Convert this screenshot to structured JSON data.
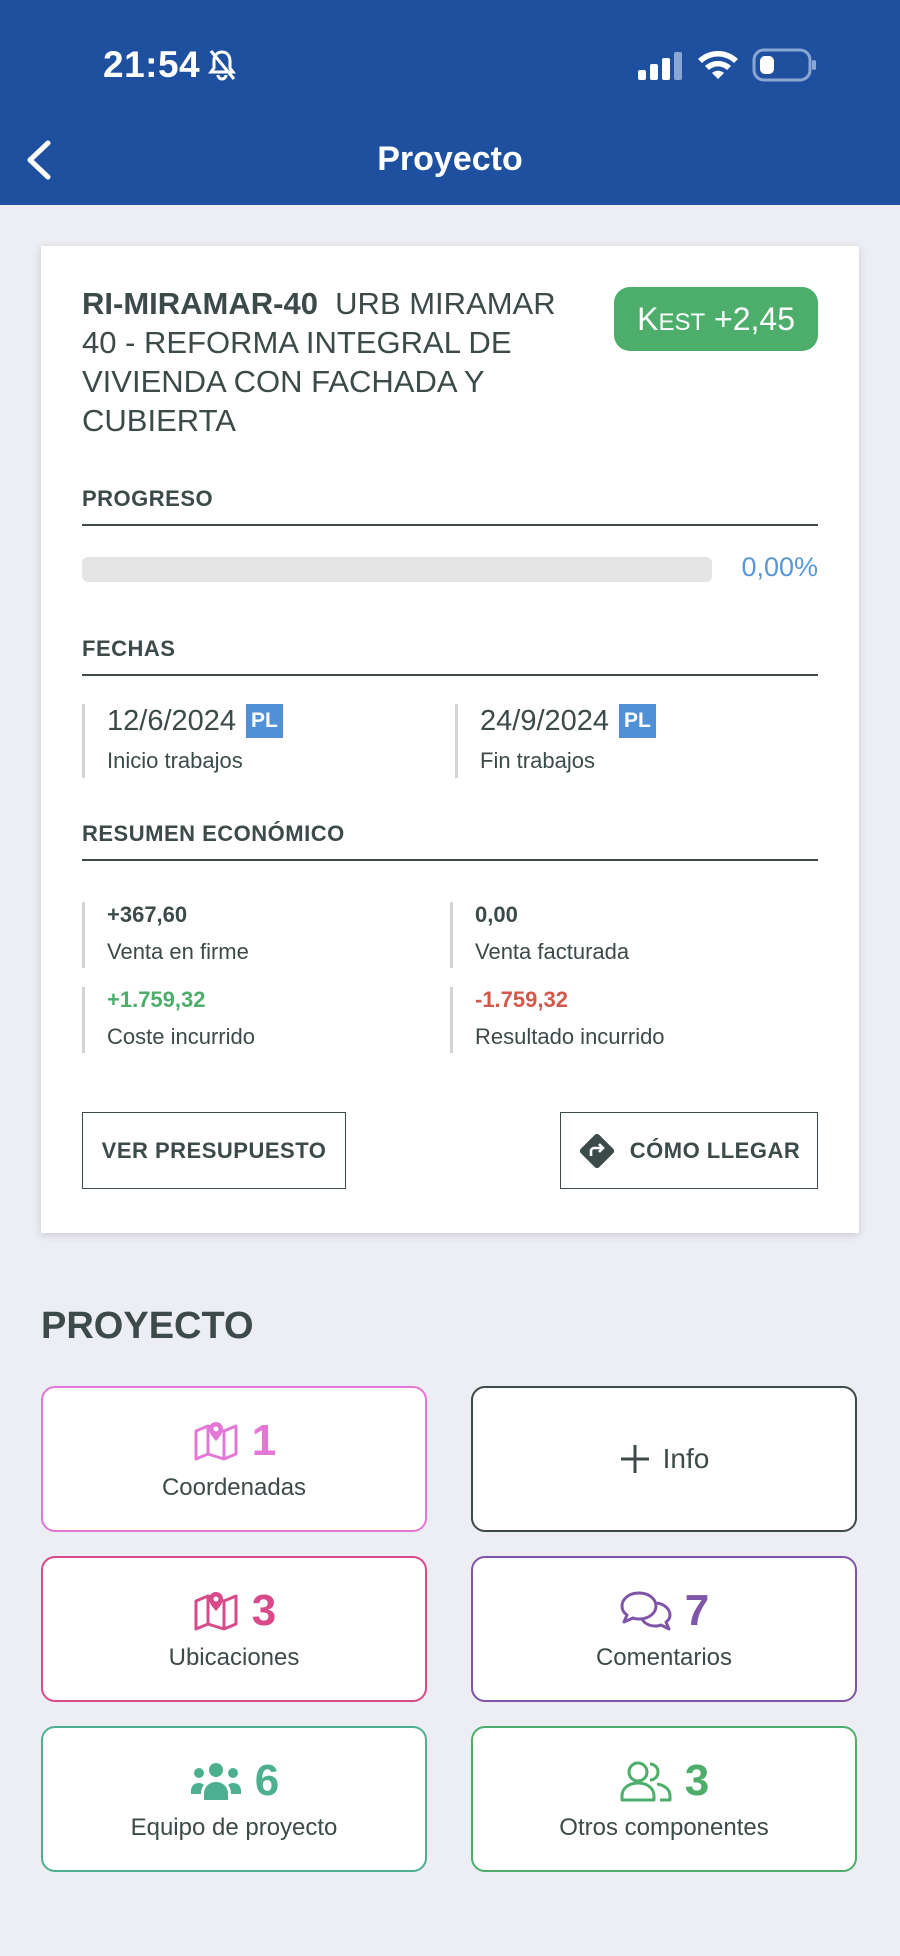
{
  "status_bar": {
    "time": "21:54"
  },
  "nav": {
    "title": "Proyecto"
  },
  "project": {
    "code": "RI-MIRAMAR-40",
    "name": "URB MIRAMAR 40 - REFORMA INTEGRAL DE VIVIENDA CON FACHADA Y CUBIERTA",
    "kest_label_k": "K",
    "kest_label_rest": "EST",
    "kest_value": "+2,45"
  },
  "progress": {
    "section_title": "PROGRESO",
    "value_fraction": 0.0,
    "percent_text": "0,00%"
  },
  "dates": {
    "section_title": "FECHAS",
    "start": {
      "value": "12/6/2024",
      "badge": "PL",
      "label": "Inicio trabajos"
    },
    "end": {
      "value": "24/9/2024",
      "badge": "PL",
      "label": "Fin trabajos"
    }
  },
  "economic": {
    "section_title": "RESUMEN ECONÓMICO",
    "venta_firme": {
      "value": "+367,60",
      "label": "Venta en firme"
    },
    "venta_facturada": {
      "value": "0,00",
      "label": "Venta facturada"
    },
    "coste_incurrido": {
      "value": "+1.759,32",
      "label": "Coste incurrido"
    },
    "resultado_incurrido": {
      "value": "-1.759,32",
      "label": "Resultado incurrido"
    }
  },
  "actions": {
    "ver_presupuesto": "VER PRESUPUESTO",
    "como_llegar": "CÓMO LLEGAR"
  },
  "proyecto_section": {
    "heading": "PROYECTO",
    "tiles": {
      "coordenadas": {
        "count": "1",
        "label": "Coordenadas",
        "color": "#e377d6"
      },
      "info": {
        "label": "Info",
        "color": "#3c4a4a"
      },
      "ubicaciones": {
        "count": "3",
        "label": "Ubicaciones",
        "color": "#d84a8a"
      },
      "comentarios": {
        "count": "7",
        "label": "Comentarios",
        "color": "#8055a8"
      },
      "equipo": {
        "count": "6",
        "label": "Equipo de proyecto",
        "color": "#4cb090"
      },
      "otros": {
        "count": "3",
        "label": "Otros componentes",
        "color": "#4cae6a"
      }
    }
  }
}
